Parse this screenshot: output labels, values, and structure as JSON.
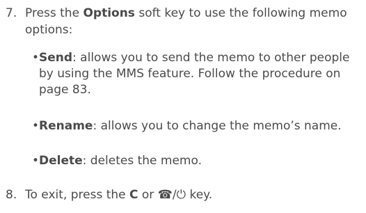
{
  "step7": {
    "number": "7.",
    "text_before": "Press the ",
    "bold": "Options",
    "text_after": " soft key to use the following memo options:"
  },
  "options": [
    {
      "bullet": "•",
      "name": "Send",
      "desc": ": allows you to send the memo to other people by using the MMS feature. Follow the procedure on page 83."
    },
    {
      "bullet": "•",
      "name": "Rename",
      "desc": ": allows you to change the memo’s name."
    },
    {
      "bullet": "•",
      "name": "Delete",
      "desc": ": deletes the memo."
    }
  ],
  "step8": {
    "number": "8.",
    "text_before": "To exit, press the ",
    "bold_key": "C",
    "text_mid": " or ",
    "key_icon": "☎/⏻",
    "text_after": " key."
  }
}
